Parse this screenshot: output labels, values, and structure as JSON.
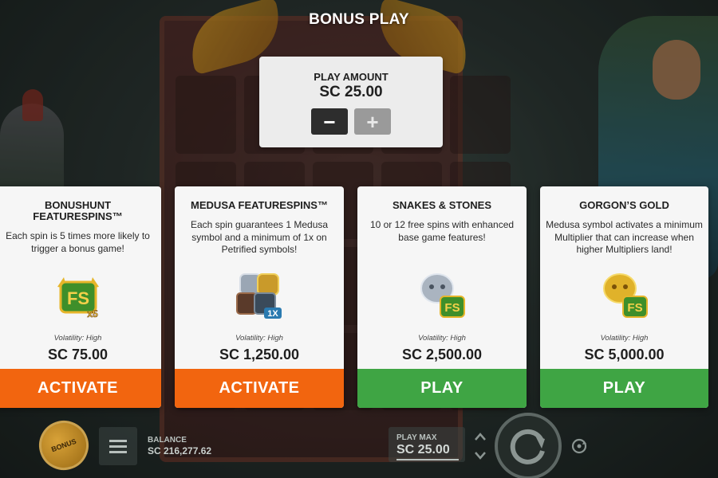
{
  "title": "BONUS PLAY",
  "play_amount": {
    "label": "PLAY AMOUNT",
    "value": "SC 25.00",
    "minus_label": "−",
    "plus_label": "+"
  },
  "cards": [
    {
      "title": "BONUSHUNT FEATURESPINS™",
      "description": "Each spin is 5 times more likely to trigger a bonus game!",
      "icon": "fs-x5-icon",
      "icon_text": "FS",
      "icon_badge": "x5",
      "volatility": "Volatility: High",
      "price": "SC 75.00",
      "button": "ACTIVATE",
      "button_color": "#f2650f"
    },
    {
      "title": "MEDUSA FEATURESPINS™",
      "description": "Each spin guarantees 1 Medusa symbol and a minimum of 1x on Petrified symbols!",
      "icon": "medusa-petrified-icon",
      "icon_text": "1X",
      "volatility": "Volatility: High",
      "price": "SC 1,250.00",
      "button": "ACTIVATE",
      "button_color": "#f2650f"
    },
    {
      "title": "SNAKES & STONES",
      "description": "10 or 12 free spins with enhanced base game features!",
      "icon": "stone-medusa-fs-icon",
      "icon_text": "FS",
      "volatility": "Volatility: High",
      "price": "SC 2,500.00",
      "button": "PLAY",
      "button_color": "#3fa544"
    },
    {
      "title": "GORGON’S GOLD",
      "description": "Medusa symbol activates a minimum Multiplier that can increase when higher Multipliers land!",
      "icon": "gold-medusa-fs-icon",
      "icon_text": "FS",
      "volatility": "Volatility: High",
      "price": "SC 5,000.00",
      "button": "PLAY",
      "button_color": "#3fa544"
    }
  ],
  "bottom_bar": {
    "bonus_label": "BONUS",
    "balance_label": "BALANCE",
    "balance_value": "SC 216,277.62",
    "play_max_label": "PLAY MAX",
    "play_max_value": "SC 25.00"
  }
}
